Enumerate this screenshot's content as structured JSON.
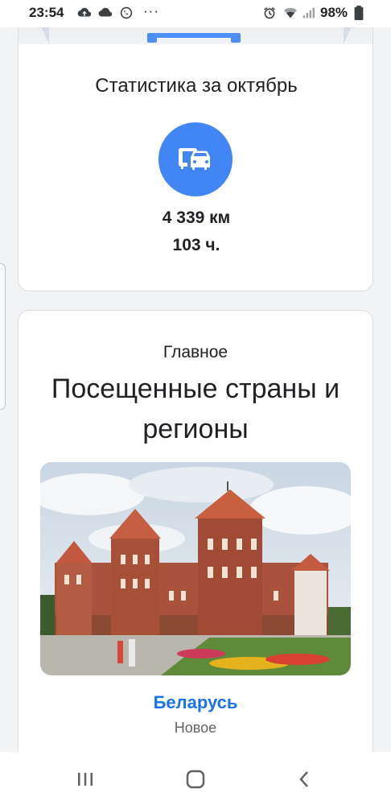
{
  "status_bar": {
    "time": "23:54",
    "left_icons": [
      "cloud-upload-icon",
      "cloud-icon",
      "whatsapp-icon"
    ],
    "more": "···",
    "right_icons": [
      "alarm-icon",
      "wifi-icon",
      "signal-icon"
    ],
    "battery": "98%",
    "battery_icon": "battery-icon"
  },
  "stats_card": {
    "title": "Статистика за октябрь",
    "icon": "driving-car-icon",
    "accent_color": "#4285f4",
    "distance": "4 339 км",
    "hours": "103 ч."
  },
  "highlights_card": {
    "label": "Главное",
    "heading": "Посещенные страны и регионы",
    "photo": "castle-photo",
    "country": "Беларусь",
    "status": "Новое",
    "link_color": "#1a73e8"
  },
  "nav_bar": {
    "recents": "recents-icon",
    "home": "home-icon",
    "back": "back-icon"
  }
}
